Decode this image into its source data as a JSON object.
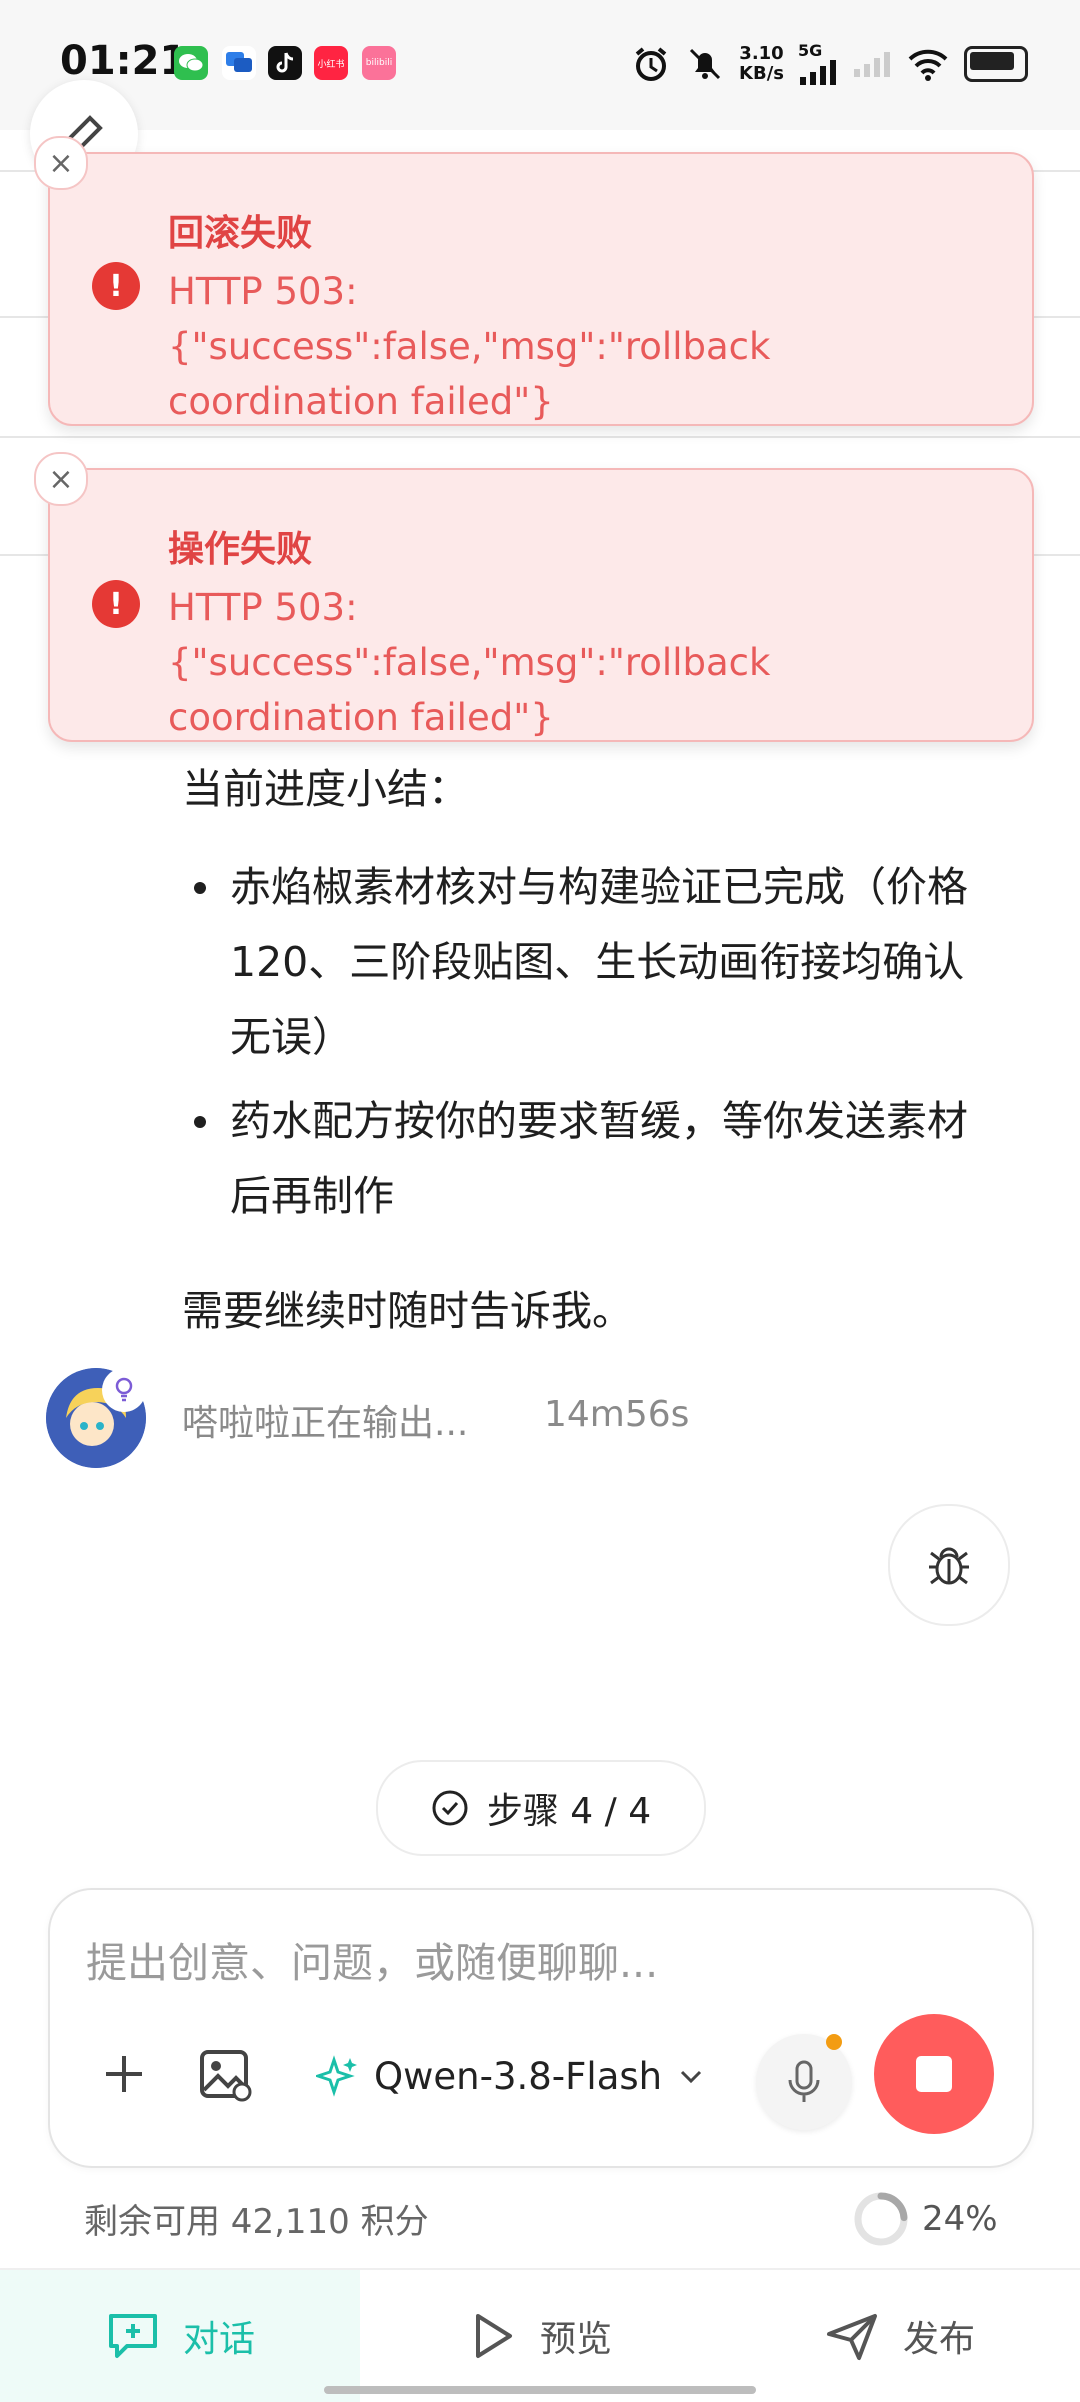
{
  "status_bar": {
    "time": "01:21",
    "net_speed_value": "3.10",
    "net_speed_unit": "KB/s",
    "network_label": "5G",
    "app_icons": [
      "wechat-icon",
      "message-icon",
      "tiktok-icon",
      "xiaohongshu-icon",
      "bilibili-icon"
    ],
    "xhs_label": "小红书",
    "bili_label": "bilibili"
  },
  "toasts": [
    {
      "title": "回滚失败",
      "message": "HTTP 503: {\"success\":false,\"msg\":\"rollback coordination failed\"}"
    },
    {
      "title": "操作失败",
      "message": "HTTP 503: {\"success\":false,\"msg\":\"rollback coordination failed\"}"
    }
  ],
  "message": {
    "summary_title": "当前进度小结：",
    "bullets": [
      "赤焰椒素材核对与构建验证已完成（价格 120、三阶段贴图、生长动画衔接均确认无误）",
      "药水配方按你的要求暂缓，等你发送素材后再制作"
    ],
    "closing": "需要继续时随时告诉我。"
  },
  "assistant_status": {
    "text": "嗒啦啦正在输出...",
    "elapsed": "14m56s"
  },
  "steps": {
    "label": "步骤 4 / 4"
  },
  "composer": {
    "placeholder": "提出创意、问题，或随便聊聊...",
    "value": "",
    "model_name": "Qwen-3.8-Flash"
  },
  "credits": {
    "text": "剩余可用 42,110 积分",
    "percent_label": "24%",
    "percent_value": 0.24
  },
  "bottom_nav": {
    "tabs": [
      {
        "label": "对话",
        "active": true
      },
      {
        "label": "预览",
        "active": false
      },
      {
        "label": "发布",
        "active": false
      }
    ]
  },
  "colors": {
    "accent": "#1bbfa9",
    "error_bg": "#fde9e9",
    "error_text": "#e04444",
    "stop_button": "#ff5c5c"
  }
}
